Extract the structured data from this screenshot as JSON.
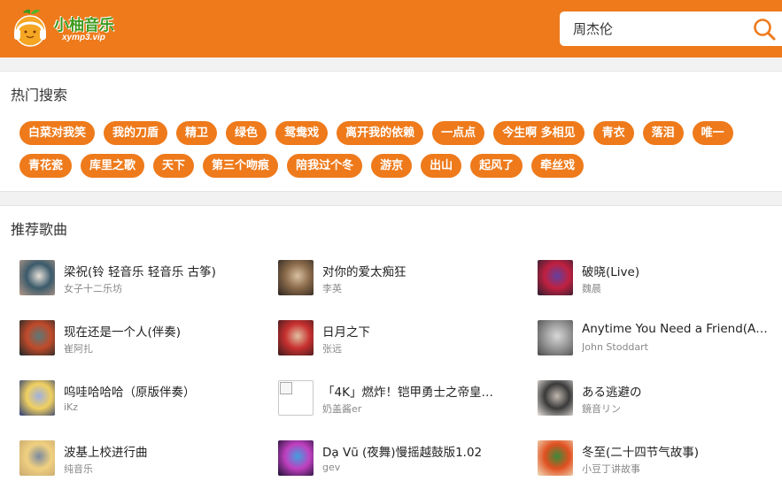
{
  "header": {
    "logo_title": "小柚音乐",
    "logo_sub": "xymp3.vip",
    "search_value": "周杰伦",
    "colors": {
      "bar": "#ee7a1b",
      "logo_green": "#3c9a1e"
    }
  },
  "hot": {
    "title": "热门搜索",
    "tags": [
      "白菜对我笑",
      "我的刀盾",
      "精卫",
      "绿色",
      "鸳鸯戏",
      "离开我的依赖",
      "一点点",
      "今生啊 多相见",
      "青衣",
      "落泪",
      "唯一",
      "青花瓷",
      "库里之歌",
      "天下",
      "第三个吻痕",
      "陪我过个冬",
      "游京",
      "出山",
      "起风了",
      "牵丝戏"
    ]
  },
  "recommend": {
    "title": "推荐歌曲",
    "songs": [
      {
        "title": "梁祝(铃 轻音乐 轻音乐 古筝)",
        "artist": "女子十二乐坊",
        "cover_colors": [
          "#b89a8a",
          "#3a5a6a",
          "#e8e0d8"
        ]
      },
      {
        "title": "对你的爱太痴狂",
        "artist": "李英",
        "cover_colors": [
          "#2a2420",
          "#8a6a4a",
          "#d8c0a0"
        ]
      },
      {
        "title": "破晓(Live)",
        "artist": "魏晨",
        "cover_colors": [
          "#2a2030",
          "#c02040",
          "#6040a0"
        ]
      },
      {
        "title": "现在还是一个人(伴奏)",
        "artist": "崔阿扎",
        "cover_colors": [
          "#1a2a2a",
          "#c04a2a",
          "#5a7a7a"
        ]
      },
      {
        "title": "日月之下",
        "artist": "张远",
        "cover_colors": [
          "#3a1a1a",
          "#c83030",
          "#e0c0a0"
        ]
      },
      {
        "title": "Anytime You Need a Friend(A…",
        "artist": "John Stoddart",
        "cover_colors": [
          "#4a4a4a",
          "#9a9a9a",
          "#d8d8d8"
        ]
      },
      {
        "title": "呜哇哈哈哈（原版伴奏）",
        "artist": "iKz",
        "cover_colors": [
          "#2a3a7a",
          "#f0d060",
          "#a0b0e0"
        ]
      },
      {
        "title": "「4K」燃炸！铠甲勇士之帝皇…",
        "artist": "奶盖酱er",
        "cover_colors": [
          "#ffffff",
          "#cccccc",
          "#eeeeee"
        ]
      },
      {
        "title": "ある逃避の",
        "artist": "鏡音リン",
        "cover_colors": [
          "#e8e4e0",
          "#3a3a3a",
          "#c0b8b0"
        ]
      },
      {
        "title": "波基上校进行曲",
        "artist": "纯音乐",
        "cover_colors": [
          "#c8a870",
          "#f0d080",
          "#7a8aa0"
        ]
      },
      {
        "title": "Dạ Vũ (夜舞)慢摇越鼓版1.02",
        "artist": "gev",
        "cover_colors": [
          "#1a1030",
          "#c040c0",
          "#40a0e0"
        ]
      },
      {
        "title": "冬至(二十四节气故事)",
        "artist": "小豆丁讲故事",
        "cover_colors": [
          "#f0e0c0",
          "#e05020",
          "#3a8a3a"
        ]
      }
    ]
  }
}
